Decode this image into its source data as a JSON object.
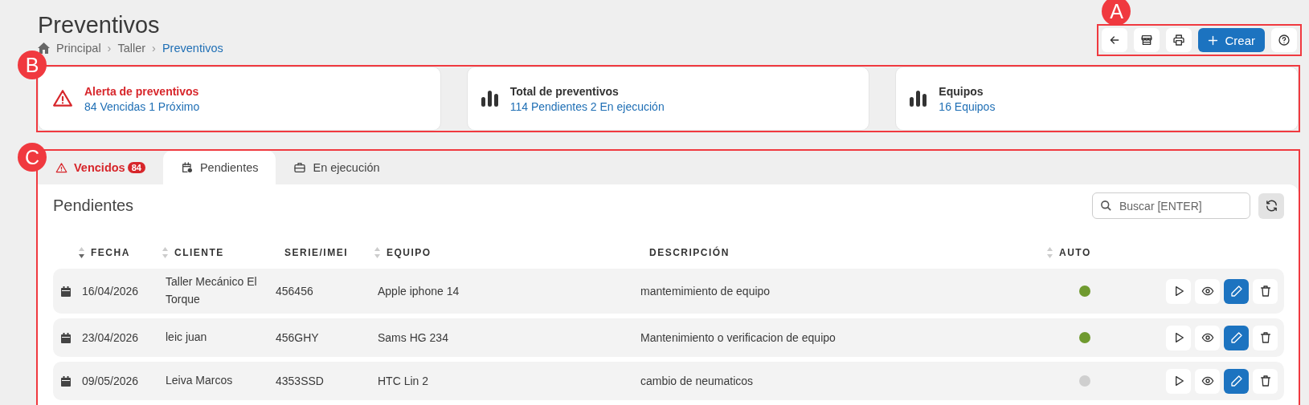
{
  "page": {
    "title": "Preventivos",
    "breadcrumb": [
      {
        "label": "Principal",
        "current": false
      },
      {
        "separator": "›",
        "label": "Taller",
        "current": false
      },
      {
        "separator": "›",
        "label": "Preventivos",
        "current": true
      }
    ]
  },
  "toolbar": {
    "callout": "A",
    "buttons": [
      {
        "kind": "back"
      },
      {
        "kind": "store"
      },
      {
        "kind": "print"
      },
      {
        "kind": "create",
        "label": "Crear"
      },
      {
        "kind": "help"
      }
    ]
  },
  "cards": {
    "callout": "B",
    "items": [
      {
        "kind": "alert",
        "title": "Alerta de preventivos",
        "summary": "84 Vencidas 1 Próximo"
      },
      {
        "kind": "stats",
        "title": "Total de preventivos",
        "summary": "114 Pendientes 2 En ejecución"
      },
      {
        "kind": "stats",
        "title": "Equipos",
        "summary": "16 Equipos"
      }
    ]
  },
  "panel": {
    "callout": "C",
    "tabs": [
      {
        "kind": "alert",
        "label": "Vencidos",
        "badge": "84",
        "selected": false
      },
      {
        "kind": "calendar",
        "label": "Pendientes",
        "selected": true
      },
      {
        "kind": "briefcase",
        "label": "En ejecución",
        "selected": false
      }
    ],
    "heading": "Pendientes",
    "search": {
      "placeholder": "Buscar [ENTER]"
    },
    "columns": [
      {
        "label": "FECHA",
        "sortable": true,
        "sorted": true
      },
      {
        "label": "CLIENTE",
        "sortable": true,
        "sorted": false
      },
      {
        "label": "SERIE/IMEI",
        "sortable": false
      },
      {
        "label": "EQUIPO",
        "sortable": true,
        "sorted": false
      },
      {
        "label": "DESCRIPCIÓN",
        "sortable": false
      },
      {
        "label": "AUTO",
        "sortable": true,
        "sorted": false
      }
    ],
    "rows": [
      {
        "fecha": "16/04/2026",
        "cliente": "Taller Mecánico El Torque",
        "serie": "456456",
        "equipo": "Apple iphone 14",
        "descripcion": "mantemimiento de equipo",
        "auto": true
      },
      {
        "fecha": "23/04/2026",
        "cliente": "leic juan",
        "serie": "456GHY",
        "equipo": "Sams HG 234",
        "descripcion": "Mantenimiento o verificacion de equipo",
        "auto": true
      },
      {
        "fecha": "09/05/2026",
        "cliente": "Leiva Marcos",
        "serie": "4353SSD",
        "equipo": "HTC Lin 2",
        "descripcion": "cambio de neumaticos",
        "auto": false
      }
    ]
  }
}
